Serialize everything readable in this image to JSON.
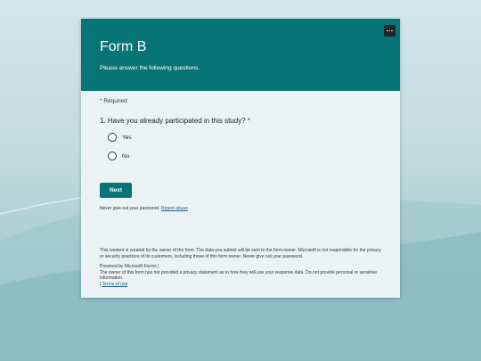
{
  "form": {
    "title": "Form B",
    "subtitle": "Please answer the following questions.",
    "more_label": "...",
    "required_star": "*",
    "required_text": "Required",
    "question": {
      "text": "1. Have you already participated in this study?",
      "star": "*",
      "options": [
        "Yes",
        "No"
      ]
    },
    "next_label": "Next",
    "password_note": "Never give out your password.",
    "report_label": "Report abuse",
    "disclaimer": "This content is created by the owner of the form. The data you submit will be sent to the form owner. Microsoft is not responsible for the privacy or security practices of its customers, including those of this form owner. Never give out your password.",
    "powered_by": "Powered by Microsoft Forms |",
    "privacy_note": "The owner of this form has not provided a privacy statement as to how they will use your response data. Do not provide personal or sensitive information.",
    "terms_separator": "|",
    "terms_label": "Terms of use"
  },
  "colors": {
    "header": "#077576",
    "accent": "#077576",
    "required": "#b3262b",
    "link": "#1f5f8f"
  }
}
